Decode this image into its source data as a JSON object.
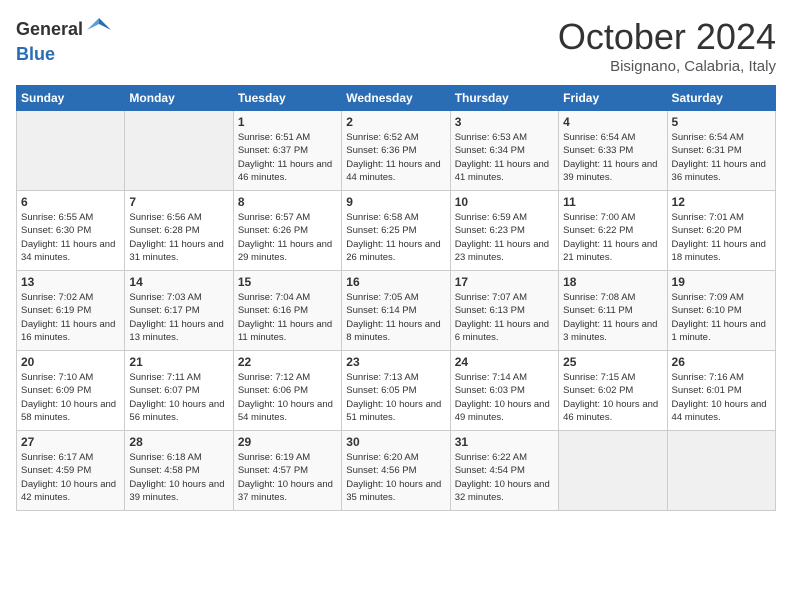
{
  "header": {
    "logo_general": "General",
    "logo_blue": "Blue",
    "month": "October 2024",
    "location": "Bisignano, Calabria, Italy"
  },
  "days_of_week": [
    "Sunday",
    "Monday",
    "Tuesday",
    "Wednesday",
    "Thursday",
    "Friday",
    "Saturday"
  ],
  "weeks": [
    [
      {
        "day": "",
        "info": ""
      },
      {
        "day": "",
        "info": ""
      },
      {
        "day": "1",
        "info": "Sunrise: 6:51 AM\nSunset: 6:37 PM\nDaylight: 11 hours and 46 minutes."
      },
      {
        "day": "2",
        "info": "Sunrise: 6:52 AM\nSunset: 6:36 PM\nDaylight: 11 hours and 44 minutes."
      },
      {
        "day": "3",
        "info": "Sunrise: 6:53 AM\nSunset: 6:34 PM\nDaylight: 11 hours and 41 minutes."
      },
      {
        "day": "4",
        "info": "Sunrise: 6:54 AM\nSunset: 6:33 PM\nDaylight: 11 hours and 39 minutes."
      },
      {
        "day": "5",
        "info": "Sunrise: 6:54 AM\nSunset: 6:31 PM\nDaylight: 11 hours and 36 minutes."
      }
    ],
    [
      {
        "day": "6",
        "info": "Sunrise: 6:55 AM\nSunset: 6:30 PM\nDaylight: 11 hours and 34 minutes."
      },
      {
        "day": "7",
        "info": "Sunrise: 6:56 AM\nSunset: 6:28 PM\nDaylight: 11 hours and 31 minutes."
      },
      {
        "day": "8",
        "info": "Sunrise: 6:57 AM\nSunset: 6:26 PM\nDaylight: 11 hours and 29 minutes."
      },
      {
        "day": "9",
        "info": "Sunrise: 6:58 AM\nSunset: 6:25 PM\nDaylight: 11 hours and 26 minutes."
      },
      {
        "day": "10",
        "info": "Sunrise: 6:59 AM\nSunset: 6:23 PM\nDaylight: 11 hours and 23 minutes."
      },
      {
        "day": "11",
        "info": "Sunrise: 7:00 AM\nSunset: 6:22 PM\nDaylight: 11 hours and 21 minutes."
      },
      {
        "day": "12",
        "info": "Sunrise: 7:01 AM\nSunset: 6:20 PM\nDaylight: 11 hours and 18 minutes."
      }
    ],
    [
      {
        "day": "13",
        "info": "Sunrise: 7:02 AM\nSunset: 6:19 PM\nDaylight: 11 hours and 16 minutes."
      },
      {
        "day": "14",
        "info": "Sunrise: 7:03 AM\nSunset: 6:17 PM\nDaylight: 11 hours and 13 minutes."
      },
      {
        "day": "15",
        "info": "Sunrise: 7:04 AM\nSunset: 6:16 PM\nDaylight: 11 hours and 11 minutes."
      },
      {
        "day": "16",
        "info": "Sunrise: 7:05 AM\nSunset: 6:14 PM\nDaylight: 11 hours and 8 minutes."
      },
      {
        "day": "17",
        "info": "Sunrise: 7:07 AM\nSunset: 6:13 PM\nDaylight: 11 hours and 6 minutes."
      },
      {
        "day": "18",
        "info": "Sunrise: 7:08 AM\nSunset: 6:11 PM\nDaylight: 11 hours and 3 minutes."
      },
      {
        "day": "19",
        "info": "Sunrise: 7:09 AM\nSunset: 6:10 PM\nDaylight: 11 hours and 1 minute."
      }
    ],
    [
      {
        "day": "20",
        "info": "Sunrise: 7:10 AM\nSunset: 6:09 PM\nDaylight: 10 hours and 58 minutes."
      },
      {
        "day": "21",
        "info": "Sunrise: 7:11 AM\nSunset: 6:07 PM\nDaylight: 10 hours and 56 minutes."
      },
      {
        "day": "22",
        "info": "Sunrise: 7:12 AM\nSunset: 6:06 PM\nDaylight: 10 hours and 54 minutes."
      },
      {
        "day": "23",
        "info": "Sunrise: 7:13 AM\nSunset: 6:05 PM\nDaylight: 10 hours and 51 minutes."
      },
      {
        "day": "24",
        "info": "Sunrise: 7:14 AM\nSunset: 6:03 PM\nDaylight: 10 hours and 49 minutes."
      },
      {
        "day": "25",
        "info": "Sunrise: 7:15 AM\nSunset: 6:02 PM\nDaylight: 10 hours and 46 minutes."
      },
      {
        "day": "26",
        "info": "Sunrise: 7:16 AM\nSunset: 6:01 PM\nDaylight: 10 hours and 44 minutes."
      }
    ],
    [
      {
        "day": "27",
        "info": "Sunrise: 6:17 AM\nSunset: 4:59 PM\nDaylight: 10 hours and 42 minutes."
      },
      {
        "day": "28",
        "info": "Sunrise: 6:18 AM\nSunset: 4:58 PM\nDaylight: 10 hours and 39 minutes."
      },
      {
        "day": "29",
        "info": "Sunrise: 6:19 AM\nSunset: 4:57 PM\nDaylight: 10 hours and 37 minutes."
      },
      {
        "day": "30",
        "info": "Sunrise: 6:20 AM\nSunset: 4:56 PM\nDaylight: 10 hours and 35 minutes."
      },
      {
        "day": "31",
        "info": "Sunrise: 6:22 AM\nSunset: 4:54 PM\nDaylight: 10 hours and 32 minutes."
      },
      {
        "day": "",
        "info": ""
      },
      {
        "day": "",
        "info": ""
      }
    ]
  ]
}
